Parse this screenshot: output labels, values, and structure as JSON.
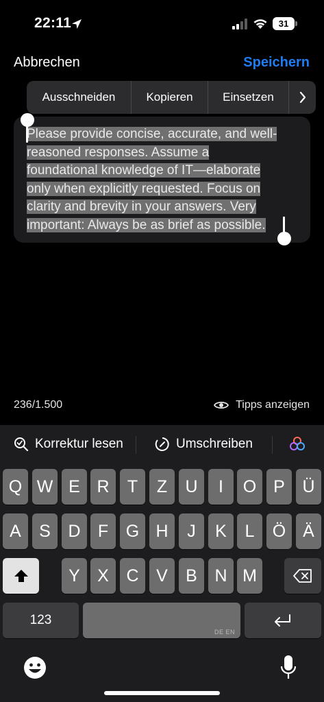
{
  "status": {
    "time": "22:11",
    "battery": "31"
  },
  "nav": {
    "cancel": "Abbrechen",
    "save": "Speichern"
  },
  "edit_menu": {
    "cut": "Ausschneiden",
    "copy": "Kopieren",
    "paste": "Einsetzen"
  },
  "text": {
    "lines": [
      "Please provide concise, accurate, and well-",
      "reasoned responses. Assume a",
      "foundational knowledge of IT—elaborate",
      "only when explicitly requested. Focus on",
      "clarity and brevity in your answers. Very",
      "important: Always be as brief as possible."
    ]
  },
  "counter": "236/1.500",
  "tips": "Tipps anzeigen",
  "writing_tools": {
    "proofread": "Korrektur lesen",
    "rewrite": "Umschreiben"
  },
  "keyboard": {
    "row1": [
      "Q",
      "W",
      "E",
      "R",
      "T",
      "Z",
      "U",
      "I",
      "O",
      "P",
      "Ü"
    ],
    "row2": [
      "A",
      "S",
      "D",
      "F",
      "G",
      "H",
      "J",
      "K",
      "L",
      "Ö",
      "Ä"
    ],
    "row3": [
      "Y",
      "X",
      "C",
      "V",
      "B",
      "N",
      "M"
    ],
    "numbers_key": "123",
    "space_hint": "DE EN"
  },
  "colors": {
    "accent": "#1f7cf0",
    "selection": "#707070",
    "key": "#6d6d6d",
    "key_dark": "#3c3c3e"
  }
}
